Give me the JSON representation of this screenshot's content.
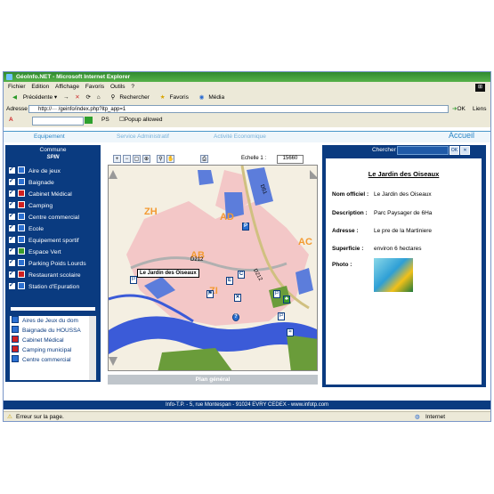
{
  "window": {
    "title": "GéoInfo.NET - Microsoft Internet Explorer"
  },
  "menu": [
    "Fichier",
    "Edition",
    "Affichage",
    "Favoris",
    "Outils",
    "?"
  ],
  "toolbar": {
    "back": "Précédente",
    "search": "Rechercher",
    "favorites": "Favoris",
    "media": "Média"
  },
  "address": {
    "label": "Adresse",
    "url": "http://··· /geinfo/index.php?itp_app=1",
    "go": "OK",
    "links": "Liens"
  },
  "extra": {
    "ps": "PS",
    "popup": "Popup allowed"
  },
  "tabs": [
    "Equipement",
    "Service Administratif",
    "Activité Economique"
  ],
  "accueil": "Accueil",
  "sidebar": {
    "commune": "Commune",
    "logo": "SPIN",
    "items": [
      {
        "label": "Aire de jeux",
        "color": "#2b6fd0"
      },
      {
        "label": "Baignade",
        "color": "#2b6fd0"
      },
      {
        "label": "Cabinet Médical",
        "color": "#d02020"
      },
      {
        "label": "Camping",
        "color": "#d02020"
      },
      {
        "label": "Centre commercial",
        "color": "#2b6fd0"
      },
      {
        "label": "Ecole",
        "color": "#2b6fd0"
      },
      {
        "label": "Equipement sportif",
        "color": "#2b6fd0"
      },
      {
        "label": "Espace Vert",
        "color": "#3a9b2a"
      },
      {
        "label": "Parking Poids Lourds",
        "color": "#2b6fd0"
      },
      {
        "label": "Restaurant scolaire",
        "color": "#d02020"
      },
      {
        "label": "Station d'Epuration",
        "color": "#2b6fd0"
      }
    ],
    "list": [
      "Aires de Jeux du dom",
      "Baignade du HOUSSA",
      "Cabinet Médical",
      "Camping municipal",
      "Centre commercial"
    ]
  },
  "map": {
    "echelle_label": "Echelle 1 :",
    "echelle_value": "15660",
    "tooltip": "Le Jardin des Oiseaux",
    "plan_label": "Plan général",
    "zone_labels": [
      "ZH",
      "AD",
      "AC",
      "ZI",
      "AB"
    ],
    "road_labels": [
      "D51",
      "D212",
      "D212"
    ]
  },
  "panel": {
    "search_label": "Chercher",
    "title": "Le Jardin des Oiseaux",
    "fields": [
      {
        "label": "Nom officiel :",
        "value": "Le Jardin des Oiseaux"
      },
      {
        "label": "Description :",
        "value": "Parc Paysager de 6Ha"
      },
      {
        "label": "Adresse :",
        "value": "Le pre de la Martiniere"
      },
      {
        "label": "Superficie :",
        "value": "environ 6 hectares"
      },
      {
        "label": "Photo :",
        "value": ""
      }
    ]
  },
  "footer": "Info-T.P. - 5, rue Montespan - 91024 EVRY CEDEX - www.infotp.com",
  "status": {
    "left": "Erreur sur la page.",
    "right": "Internet"
  }
}
